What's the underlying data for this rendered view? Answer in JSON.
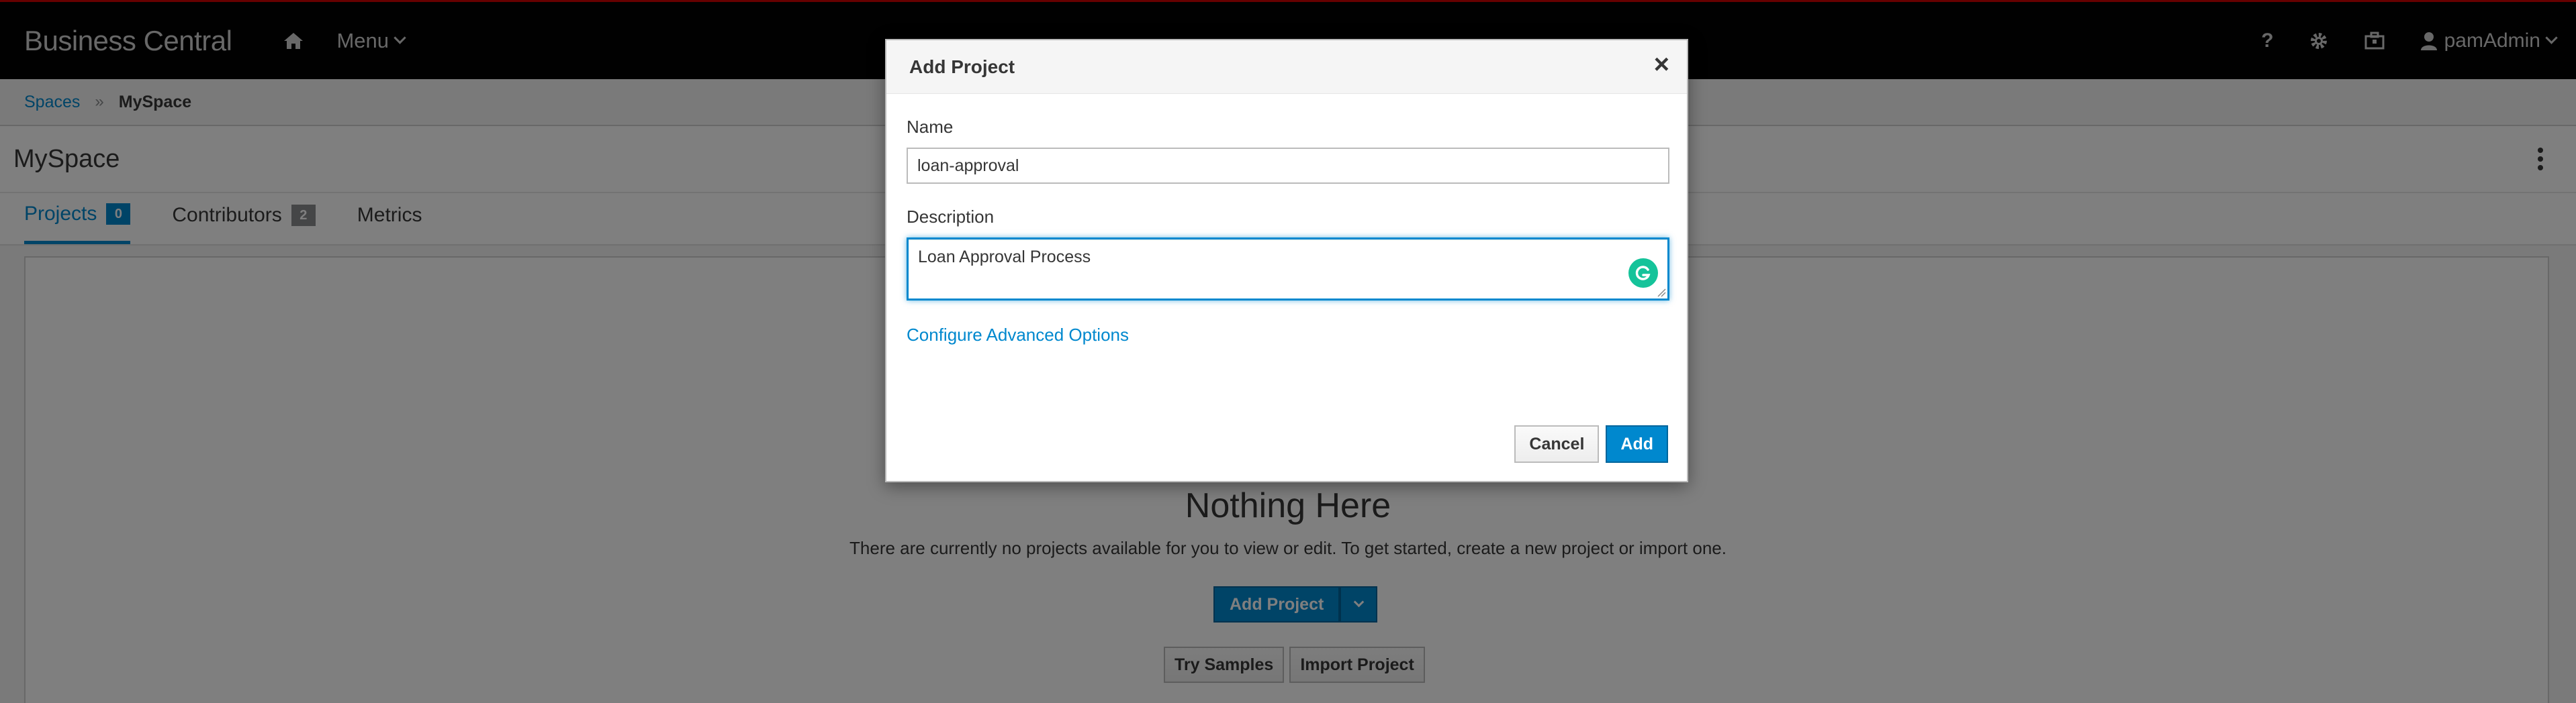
{
  "app": {
    "brand": "Business Central",
    "menu_label": "Menu",
    "help_label": "?",
    "user_label": "pamAdmin"
  },
  "breadcrumb": {
    "root": "Spaces",
    "separator": "»",
    "current": "MySpace"
  },
  "page": {
    "title": "MySpace"
  },
  "tabs": [
    {
      "label": "Projects",
      "badge": "0",
      "active": true
    },
    {
      "label": "Contributors",
      "badge": "2",
      "active": false
    },
    {
      "label": "Metrics",
      "active": false
    }
  ],
  "empty_state": {
    "title": "Nothing Here",
    "description": "There are currently no projects available for you to view or edit. To get started, create a new project or import one.",
    "add_project_label": "Add Project",
    "try_samples_label": "Try Samples",
    "import_project_label": "Import Project"
  },
  "modal": {
    "title": "Add Project",
    "close_glyph": "×",
    "name_label": "Name",
    "name_value": "loan-approval",
    "description_label": "Description",
    "description_value": "Loan Approval Process",
    "advanced_link": "Configure Advanced Options",
    "cancel_label": "Cancel",
    "add_label": "Add"
  },
  "colors": {
    "accent": "#0088ce",
    "topbar": "#030303",
    "grammarly": "#15c39a"
  }
}
